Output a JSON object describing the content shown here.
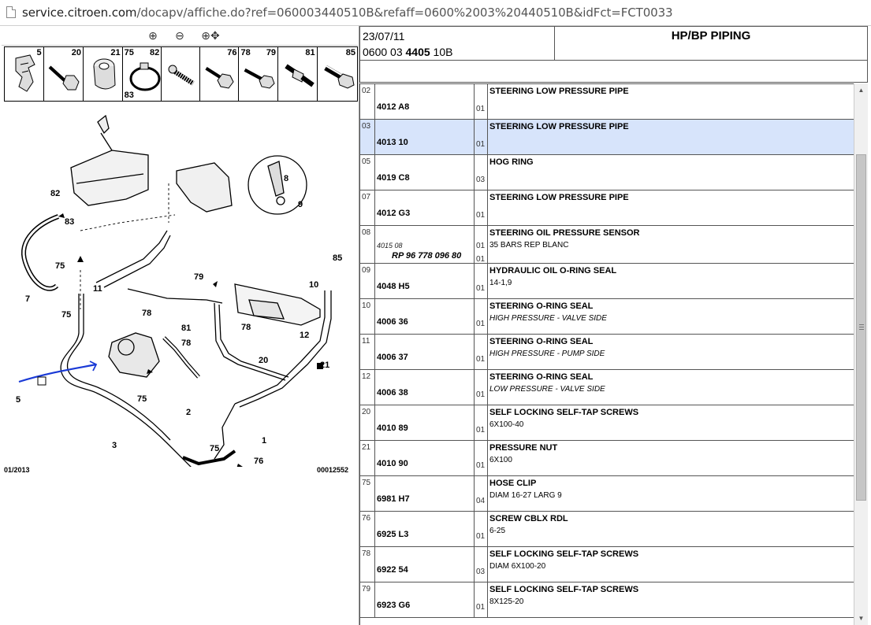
{
  "browser": {
    "url_host": "service.citroen.com",
    "url_path": "/docapv/affiche.do?ref=060003440510B&refaff=0600%2003%20440510B&idFct=FCT0033"
  },
  "diagram": {
    "toolbar": {
      "zoom_in": "⊕",
      "zoom_out": "⊖",
      "zoom_pan": "⊕✥"
    },
    "strip_numbers": [
      "5",
      "20",
      "21",
      "75",
      "83",
      "82",
      "76",
      "78",
      "79",
      "81",
      "85"
    ],
    "callouts": [
      "8",
      "9",
      "82",
      "83",
      "75",
      "7",
      "75",
      "11",
      "78",
      "79",
      "78",
      "81",
      "78",
      "10",
      "12",
      "85",
      "20",
      "21",
      "5",
      "75",
      "2",
      "3",
      "1",
      "75",
      "76",
      "5"
    ],
    "footer_left": "01/2013",
    "footer_right": "00012552"
  },
  "header": {
    "date": "23/07/11",
    "code_prefix": "0600 03 ",
    "code_bold": "4405",
    "code_suffix": " 10B",
    "title": "HP/BP PIPING"
  },
  "parts": [
    {
      "pos": "02",
      "ref": "4012 A8",
      "qty": "01",
      "desc": "STEERING LOW PRESSURE PIPE",
      "detail": ""
    },
    {
      "pos": "03",
      "ref": "4013 10",
      "qty": "01",
      "desc": "STEERING LOW PRESSURE PIPE",
      "detail": ""
    },
    {
      "pos": "05",
      "ref": "4019 C8",
      "qty": "03",
      "desc": "HOG RING",
      "detail": ""
    },
    {
      "pos": "07",
      "ref": "4012 G3",
      "qty": "01",
      "desc": "STEERING LOW PRESSURE PIPE",
      "detail": ""
    },
    {
      "pos": "08",
      "ref": "4015 08",
      "qty": "01",
      "desc": "STEERING OIL PRESSURE SENSOR",
      "detail": "35 BARS REP BLANC",
      "rp": "RP 96 778 096 80",
      "qty2": "01"
    },
    {
      "pos": "09",
      "ref": "4048 H5",
      "qty": "01",
      "desc": "HYDRAULIC OIL O-RING SEAL",
      "detail": "14-1,9"
    },
    {
      "pos": "10",
      "ref": "4006 36",
      "qty": "01",
      "desc": "STEERING O-RING SEAL",
      "detail": "HIGH PRESSURE - VALVE SIDE"
    },
    {
      "pos": "11",
      "ref": "4006 37",
      "qty": "01",
      "desc": "STEERING O-RING SEAL",
      "detail": "HIGH PRESSURE - PUMP SIDE"
    },
    {
      "pos": "12",
      "ref": "4006 38",
      "qty": "01",
      "desc": "STEERING O-RING SEAL",
      "detail": "LOW PRESSURE - VALVE SIDE"
    },
    {
      "pos": "20",
      "ref": "4010 89",
      "qty": "01",
      "desc": "SELF LOCKING SELF-TAP SCREWS",
      "detail": "6X100-40"
    },
    {
      "pos": "21",
      "ref": "4010 90",
      "qty": "01",
      "desc": "PRESSURE NUT",
      "detail": "6X100"
    },
    {
      "pos": "75",
      "ref": "6981 H7",
      "qty": "04",
      "desc": "HOSE CLIP",
      "detail": "DIAM 16-27 LARG 9"
    },
    {
      "pos": "76",
      "ref": "6925 L3",
      "qty": "01",
      "desc": "SCREW CBLX RDL",
      "detail": "6-25"
    },
    {
      "pos": "78",
      "ref": "6922 54",
      "qty": "03",
      "desc": "SELF LOCKING SELF-TAP SCREWS",
      "detail": "DIAM 6X100-20"
    },
    {
      "pos": "79",
      "ref": "6923 G6",
      "qty": "01",
      "desc": "SELF LOCKING SELF-TAP SCREWS",
      "detail": "8X125-20"
    }
  ]
}
